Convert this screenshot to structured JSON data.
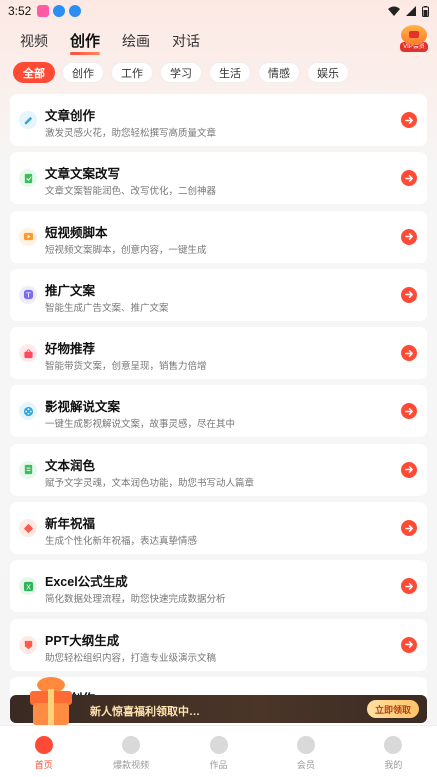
{
  "status_bar": {
    "time": "3:52"
  },
  "top_tabs": [
    {
      "label": "视频",
      "active": false
    },
    {
      "label": "创作",
      "active": true
    },
    {
      "label": "绘画",
      "active": false
    },
    {
      "label": "对话",
      "active": false
    }
  ],
  "vip": {
    "label": "VIP会员"
  },
  "filters": [
    {
      "label": "全部",
      "active": true
    },
    {
      "label": "创作",
      "active": false
    },
    {
      "label": "工作",
      "active": false
    },
    {
      "label": "学习",
      "active": false
    },
    {
      "label": "生活",
      "active": false
    },
    {
      "label": "情感",
      "active": false
    },
    {
      "label": "娱乐",
      "active": false
    }
  ],
  "cards": [
    {
      "title": "文章创作",
      "desc": "激发灵感火花，助您轻松撰写高质量文章",
      "icon": "pen-icon",
      "color": "#2ea7e0",
      "bg": "#e6f4fc"
    },
    {
      "title": "文章文案改写",
      "desc": "文章文案智能润色、改写优化，二创神器",
      "icon": "rewrite-icon",
      "color": "#3bbf5a",
      "bg": "#e7f8ec"
    },
    {
      "title": "短视频脚本",
      "desc": "短视频文案脚本，创意内容，一键生成",
      "icon": "video-script-icon",
      "color": "#ff9a2e",
      "bg": "#fff2e3"
    },
    {
      "title": "推广文案",
      "desc": "智能生成广告文案、推广文案",
      "icon": "megaphone-icon",
      "color": "#7b6cf0",
      "bg": "#efedfd"
    },
    {
      "title": "好物推荐",
      "desc": "智能带货文案，创意呈现，销售力倍增",
      "icon": "shopping-bag-icon",
      "color": "#ff4b5c",
      "bg": "#ffe9eb"
    },
    {
      "title": "影视解说文案",
      "desc": "一键生成影视解说文案，故事灵感，尽在其中",
      "icon": "film-reel-icon",
      "color": "#2ea7e0",
      "bg": "#e6f4fc"
    },
    {
      "title": "文本润色",
      "desc": "赋予文字灵魂，文本润色功能，助您书写动人篇章",
      "icon": "document-icon",
      "color": "#3bbf5a",
      "bg": "#e7f8ec"
    },
    {
      "title": "新年祝福",
      "desc": "生成个性化新年祝福，表达真挚情感",
      "icon": "blessing-icon",
      "color": "#ff5a4a",
      "bg": "#ffeae7"
    },
    {
      "title": "Excel公式生成",
      "desc": "简化数据处理流程，助您快速完成数据分析",
      "icon": "excel-icon",
      "color": "#2fb45a",
      "bg": "#e5f7eb"
    },
    {
      "title": "PPT大纲生成",
      "desc": "助您轻松组织内容，打造专业级演示文稿",
      "icon": "ppt-icon",
      "color": "#ff5a4a",
      "bg": "#ffeae7"
    },
    {
      "title": "…篇创作",
      "desc": "…力",
      "icon": "pen-icon",
      "color": "#2ea7e0",
      "bg": "#e6f4fc"
    }
  ],
  "promo": {
    "text": "新人惊喜福利领取中…",
    "button": "立即领取"
  },
  "bottom_nav": [
    {
      "label": "首页",
      "active": true,
      "icon": "home-icon"
    },
    {
      "label": "爆款视频",
      "active": false,
      "icon": "fire-icon"
    },
    {
      "label": "作品",
      "active": false,
      "icon": "folder-icon"
    },
    {
      "label": "会员",
      "active": false,
      "icon": "crown-icon"
    },
    {
      "label": "我的",
      "active": false,
      "icon": "profile-icon"
    }
  ],
  "colors": {
    "accent": "#ff4b36",
    "promo_bg": "#3f2e25"
  }
}
